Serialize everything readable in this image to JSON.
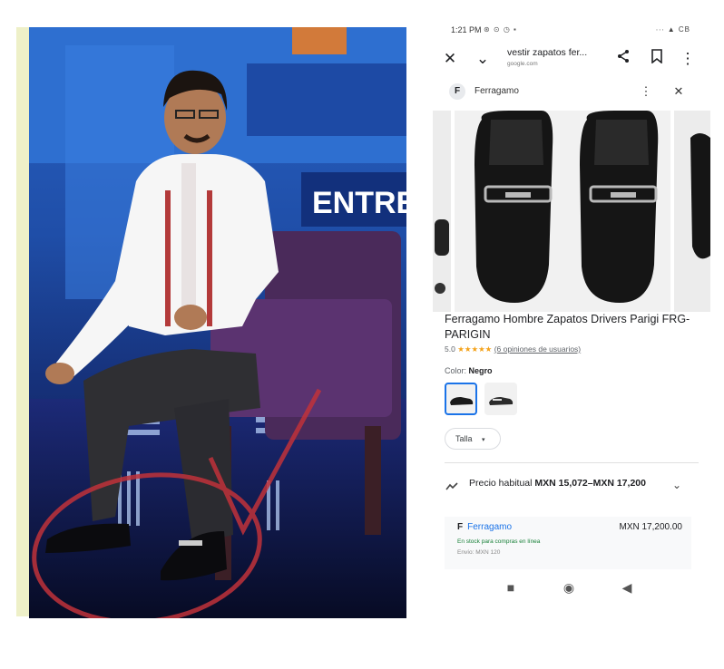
{
  "photo": {
    "stage_text": "ENTRE"
  },
  "phone": {
    "status": {
      "time": "1:21 PM",
      "icons": "⊛ ⊙ ◷ ▪",
      "right": "∙∙∙ ▲ CB"
    },
    "topbar": {
      "title": "vestir zapatos fer...",
      "url": "google.com"
    },
    "card": {
      "brand_initial": "F",
      "brand_name": "Ferragamo"
    },
    "product": {
      "title": "Ferragamo Hombre Zapatos Drivers Parigi FRG-PARIGIN",
      "rating_value": "5.0",
      "stars": "★★★★★",
      "reviews": "(6 opiniones de usuarios)",
      "color_label": "Color:",
      "color_value": "Negro",
      "size_label": "Talla"
    },
    "price": {
      "label": "Precio habitual",
      "range": "MXN 15,072–MXN 17,200"
    },
    "offer": {
      "brand_initial": "F",
      "brand_name": "Ferragamo",
      "price": "MXN 17,200.00",
      "stock": "En stock para compras en línea",
      "shipping": "Envío: MXN 120"
    },
    "icons": {
      "close": "close-icon",
      "chevron": "chevron-down-icon",
      "share": "share-icon",
      "bookmark": "bookmark-icon",
      "menu": "more-vert-icon",
      "trend": "trend-icon",
      "expand": "chevron-down-icon",
      "nav_recent": "recent-apps-icon",
      "nav_home": "home-icon",
      "nav_back": "back-icon"
    },
    "colors": {
      "link": "#1a73e8",
      "star": "#f4a21a",
      "stock": "#188038"
    }
  }
}
